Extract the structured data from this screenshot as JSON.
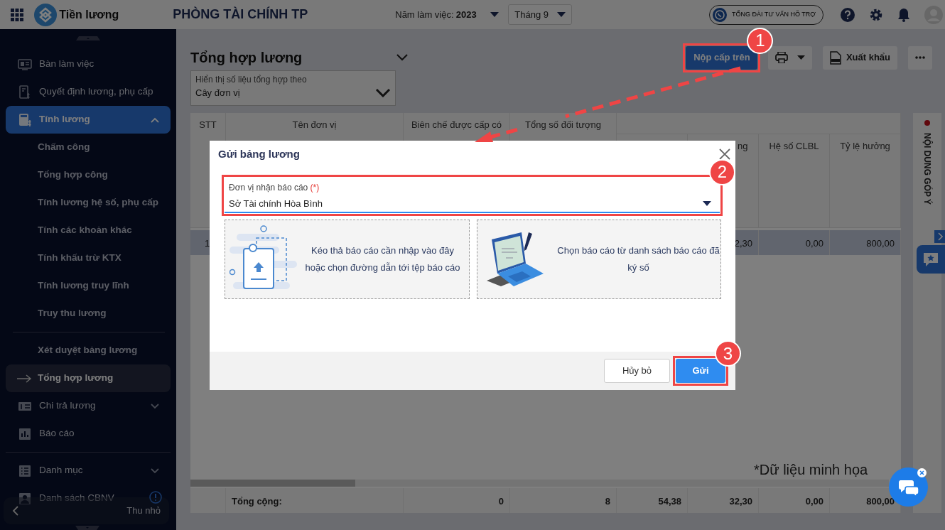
{
  "app": {
    "name": "Tiền lương"
  },
  "header": {
    "title": "PHÒNG TÀI CHÍNH TP",
    "year_label": "Năm làm việc:",
    "year": "2023",
    "month": "Tháng 9",
    "hotline": "TỔNG ĐÀI TƯ VẤN HỖ TRỢ"
  },
  "sidebar": {
    "groups": [
      {
        "items": [
          {
            "label": "Bàn làm việc",
            "selected": false
          },
          {
            "label": "Quyết định lương, phụ cấp",
            "selected": false
          },
          {
            "label": "Tính lương",
            "selected": true,
            "expanded": true,
            "children": [
              {
                "kind": "link",
                "label": "Chấm công",
                "selected": false
              },
              {
                "kind": "link",
                "label": "Tổng hợp công",
                "selected": false
              },
              {
                "kind": "link",
                "label": "Tính lương hệ số, phụ cấp",
                "selected": false
              },
              {
                "kind": "link",
                "label": "Tính các khoản khác",
                "selected": false
              },
              {
                "kind": "link",
                "label": "Tính khấu trừ KTX",
                "selected": false
              },
              {
                "kind": "link",
                "label": "Tính lương truy lĩnh",
                "selected": false
              },
              {
                "kind": "link",
                "label": "Truy thu lương",
                "selected": false
              },
              {
                "kind": "divider"
              },
              {
                "kind": "link",
                "label": "Xét duyệt bảng lương",
                "selected": false
              },
              {
                "kind": "link",
                "label": "Tổng hợp lương",
                "selected": true
              }
            ]
          },
          {
            "label": "Chi trả lương",
            "selected": false,
            "expanded": false
          },
          {
            "label": "Báo cáo",
            "selected": false
          }
        ]
      },
      {
        "items": [
          {
            "label": "Danh mục",
            "selected": false,
            "expanded": false
          },
          {
            "label": "Danh sách CBNV",
            "selected": false
          }
        ]
      }
    ],
    "collapse_label": "Thu nhỏ"
  },
  "page": {
    "title": "Tổng hợp lương",
    "actions": [
      {
        "kind": "primary",
        "label": "Nộp cấp trên",
        "annotation": "1"
      },
      {
        "kind": "print"
      },
      {
        "kind": "export",
        "label": "Xuất khẩu"
      },
      {
        "kind": "more"
      }
    ],
    "filter": {
      "label": "Hiển thị số liệu tổng hợp theo",
      "value": "Cây đơn vị"
    }
  },
  "table": {
    "columns": [
      "STT",
      "Tên đơn vị",
      "Biên chế được cấp có",
      "Tổng số đối tượng"
    ],
    "sub_columns": [
      "ng",
      "Hệ số CLBL",
      "Tỷ lệ hưởng"
    ],
    "rows": [
      {
        "selected": true,
        "cells": [
          "1",
          "2,30",
          "0,00",
          "800,00"
        ]
      }
    ],
    "footer": {
      "label": "Tổng cộng:",
      "values": [
        "0",
        "8",
        "54,38",
        "32,30",
        "0,00",
        "800,00"
      ]
    }
  },
  "feedback_panel": {
    "title": "NỘI DUNG GÓP Ý"
  },
  "dialog": {
    "title": "Gửi bảng lương",
    "field": {
      "label": "Đơn vị nhận báo cáo",
      "required_mark": "(*)",
      "value": "Sở Tài chính Hòa Bình",
      "annotation": "2"
    },
    "drop_zones": [
      {
        "kind": "upload",
        "text": "Kéo thả báo cáo cần nhập vào đây hoặc chọn đường dẫn tới tệp báo cáo"
      },
      {
        "kind": "signed",
        "text": "Chọn báo cáo từ danh sách báo cáo đã ký số"
      }
    ],
    "buttons": [
      {
        "kind": "secondary",
        "label": "Hủy bỏ"
      },
      {
        "kind": "primary",
        "label": "Gửi",
        "annotation": "3"
      }
    ]
  },
  "note": "*Dữ liệu minh họa"
}
